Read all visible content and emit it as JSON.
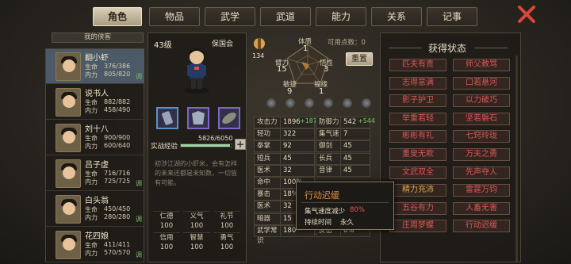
{
  "tabs": [
    {
      "label": "角色",
      "active": true,
      "dot": false
    },
    {
      "label": "物品",
      "active": false,
      "dot": true
    },
    {
      "label": "武学",
      "active": false,
      "dot": false
    },
    {
      "label": "武道",
      "active": false,
      "dot": true
    },
    {
      "label": "能力",
      "active": false,
      "dot": false
    },
    {
      "label": "关系",
      "active": false,
      "dot": false
    },
    {
      "label": "记事",
      "active": false,
      "dot": false
    }
  ],
  "party_header": "我的侠客",
  "characters": [
    {
      "name": "翻小虾",
      "hp_label": "生命",
      "hp": "376/386",
      "mp_label": "内力",
      "mp": "805/820",
      "tag": "调",
      "selected": true
    },
    {
      "name": "说书人",
      "hp_label": "生命",
      "hp": "882/882",
      "mp_label": "内力",
      "mp": "458/490",
      "tag": "",
      "selected": false
    },
    {
      "name": "刘十八",
      "hp_label": "生命",
      "hp": "900/900",
      "mp_label": "内力",
      "mp": "600/640",
      "tag": "",
      "selected": false
    },
    {
      "name": "吕子虚",
      "hp_label": "生命",
      "hp": "716/716",
      "mp_label": "内力",
      "mp": "725/725",
      "tag": "调",
      "selected": false
    },
    {
      "name": "白头翁",
      "hp_label": "生命",
      "hp": "450/450",
      "mp_label": "内力",
      "mp": "280/280",
      "tag": "调",
      "selected": false
    },
    {
      "name": "花四娘",
      "hp_label": "生命",
      "hp": "411/411",
      "mp_label": "内力",
      "mp": "570/570",
      "tag": "调",
      "selected": false
    }
  ],
  "hero": {
    "level": "43级",
    "faction": "保国会",
    "exp_label": "实战经验",
    "exp": "5826/6050",
    "exp_fraction": 0.963,
    "desc": "初涉江湖的小虾米，会有怎样的未来还都是未知数，一切皆有可能。"
  },
  "virtues": [
    {
      "label": "仁德",
      "value": "100"
    },
    {
      "label": "义气",
      "value": "100"
    },
    {
      "label": "礼节",
      "value": "100"
    },
    {
      "label": "信用",
      "value": "100"
    },
    {
      "label": "智慧",
      "value": "100"
    },
    {
      "label": "勇气",
      "value": "100"
    }
  ],
  "attrs": {
    "points": "134",
    "free_label": "可用点数：0",
    "reset": "重置",
    "tizhi_label": "体质",
    "tizhi": "1",
    "biili_label": "臂力",
    "bili": "15",
    "wuxing_label": "悟性",
    "wuxing": "3",
    "minjie_label": "敏捷",
    "minjie": "9",
    "fuyuan_label": "福缘",
    "fuyuan": "1"
  },
  "stats": [
    {
      "l": "攻击力",
      "v": "1896",
      "b": "+187",
      "l2": "防御力",
      "v2": "542",
      "b2": "+544"
    },
    {
      "l": "轻功",
      "v": "322",
      "b": "",
      "l2": "集气速度",
      "v2": "7",
      "b2": ""
    },
    {
      "l": "拳掌",
      "v": "92",
      "b": "",
      "l2": "御剑",
      "v2": "45",
      "b2": ""
    },
    {
      "l": "短兵",
      "v": "45",
      "b": "",
      "l2": "长兵",
      "v2": "45",
      "b2": ""
    },
    {
      "l": "医术",
      "v": "32",
      "b": "",
      "l2": "音律",
      "v2": "45",
      "b2": ""
    },
    {
      "l": "命中",
      "v": "100%",
      "b": "",
      "l2": "",
      "v2": "",
      "b2": ""
    },
    {
      "l": "暴击",
      "v": "18%",
      "b": "",
      "l2": "",
      "v2": "",
      "b2": ""
    },
    {
      "l": "医术",
      "v": "32",
      "b": "",
      "l2": "",
      "v2": "",
      "b2": ""
    },
    {
      "l": "暗器",
      "v": "15",
      "b": "",
      "l2": "",
      "v2": "",
      "b2": ""
    },
    {
      "l": "武学常识",
      "v": "180",
      "b": "",
      "l2": "反击",
      "v2": "0%",
      "b2": ""
    }
  ],
  "tooltip": {
    "title": "行动迟缓",
    "effect_label": "集气速度减少",
    "effect_value": "80%",
    "dur_label": "持续时间",
    "dur_value": "永久"
  },
  "status_header": "获得状态",
  "statuses": [
    {
      "t": "匹夫有责",
      "g": false
    },
    {
      "t": "师父教骂",
      "g": false
    },
    {
      "t": "志得意满",
      "g": false
    },
    {
      "t": "口若悬河",
      "g": false
    },
    {
      "t": "影子护卫",
      "g": false
    },
    {
      "t": "以力破巧",
      "g": false
    },
    {
      "t": "举重若轻",
      "g": false
    },
    {
      "t": "坚若磐石",
      "g": false
    },
    {
      "t": "彬彬有礼",
      "g": false
    },
    {
      "t": "七窍玲珑",
      "g": false
    },
    {
      "t": "重叟无欺",
      "g": false
    },
    {
      "t": "万夫之勇",
      "g": false
    },
    {
      "t": "文武双全",
      "g": false
    },
    {
      "t": "先声夺人",
      "g": false
    },
    {
      "t": "精力充沛",
      "g": true
    },
    {
      "t": "雷霆万钧",
      "g": false
    },
    {
      "t": "五谷有力",
      "g": false
    },
    {
      "t": "人畜无害",
      "g": false
    },
    {
      "t": "庄周梦蝶",
      "g": false
    },
    {
      "t": "行动迟缓",
      "g": false
    }
  ]
}
